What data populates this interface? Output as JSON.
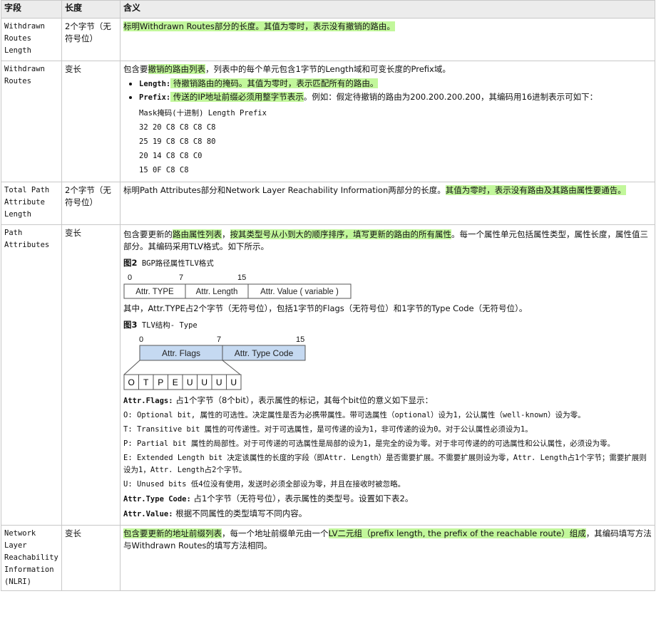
{
  "headers": [
    "字段",
    "长度",
    "含义"
  ],
  "rows": {
    "r1": {
      "field": "Withdrawn Routes Length",
      "length": "2个字节（无符号位）",
      "desc_a": "标明Withdrawn Routes部分的长度。其值为零时，表示没有撤销的路由。"
    },
    "r2": {
      "field": "Withdrawn Routes",
      "length": "变长",
      "intro_a": "包含要",
      "intro_hl": "撤销的路由列表",
      "intro_b": "，列表中的每个单元包含1字节的Length域和可变长度的Prefix域。",
      "b1_term": "Length:",
      "b1_text": " 待撤销路由的掩码。其值为零时，表示匹配所有的路由。",
      "b2_term": "Prefix:",
      "b2_hl": " 传送的IP地址前缀必须用整字节表示",
      "b2_text": "。例如：假定待撤销的路由为200.200.200.200，其编码用16进制表示可如下：",
      "ex_header": "Mask掩码(十进制) Length Prefix",
      "ex_lines": [
        "32 20 C8 C8 C8 C8",
        "25 19 C8 C8 C8 80",
        "20 14 C8 C8 C0",
        "15 0F C8 C8"
      ]
    },
    "r3": {
      "field": "Total Path Attribute Length",
      "length": "2个字节（无符号位）",
      "desc_a": "标明Path Attributes部分和Network Layer Reachability Information两部分的长度。",
      "desc_hl": "其值为零时，表示没有路由及其路由属性要通告。"
    },
    "r4": {
      "field": "Path Attributes",
      "length": "变长",
      "intro_a": "包含要更新的",
      "intro_hl1": "路由属性列表",
      "intro_b": "，",
      "intro_hl2": "按其类型号从小到大的顺序排序，填写更新的路由的所有属性",
      "intro_c": "。每一个属性单元包括属性类型，属性长度，属性值三部分。其编码采用TLV格式。如下所示。",
      "fig2_num": "图2",
      "fig2_title": " BGP路径属性TLV格式",
      "fig2_ticks": [
        "0",
        "7",
        "15"
      ],
      "fig2_cells": [
        "Attr. TYPE",
        "Attr. Length",
        "Attr. Value ( variable )"
      ],
      "after_fig2": "其中，Attr.TYPE占2个字节（无符号位），包括1字节的Flags（无符号位）和1字节的Type Code（无符号位）。",
      "fig3_num": "图3",
      "fig3_title": " TLV结构- Type",
      "fig3_ticks": [
        "0",
        "7",
        "15"
      ],
      "fig3_cells": [
        "Attr. Flags",
        "Attr. Type Code"
      ],
      "fig3_bits": [
        "O",
        "T",
        "P",
        "E",
        "U",
        "U",
        "U",
        "U"
      ],
      "flags_term": "Attr.Flags:",
      "flags_text": " 占1个字节（8个bit），表示属性的标记，其每个bit位的意义如下显示：",
      "o_line": "O: Optional bit, 属性的可选性。决定属性是否为必携带属性。带可选属性（optional）设为1，公认属性（well-known）设为零。",
      "t_line": "T: Transitive bit 属性的可传递性。对于可选属性，是可传递的设为1，非可传递的设为0。对于公认属性必须设为1。",
      "p_line": "P: Partial bit 属性的局部性。对于可传递的可选属性是局部的设为1，是完全的设为零。对于非可传递的的可选属性和公认属性，必须设为零。",
      "e_line": "E: Extended Length bit 决定该属性的长度的字段（即Attr. Length）是否需要扩展。不需要扩展则设为零，Attr. Length占1个字节；需要扩展则设为1，Attr. Length占2个字节。",
      "u_line": "U: Unused bits 低4位没有使用，发送时必须全部设为零，并且在接收时被忽略。",
      "tc_term": "Attr.Type Code:",
      "tc_text": " 占1个字节（无符号位），表示属性的类型号。设置如下表2。",
      "val_term": "Attr.Value:",
      "val_text": " 根据不同属性的类型填写不同内容。"
    },
    "r5": {
      "field": "Network Layer Reachability Information (NLRI)",
      "length": "变长",
      "hl_a": "包含要更新的地址前缀列表",
      "text_b": "，每一个地址前缀单元由一个",
      "hl_b": "LV二元组（prefix length, the prefix of the reachable route）组成",
      "text_c": "，其编码填写方法与Withdrawn Routes的填写方法相同。"
    }
  }
}
